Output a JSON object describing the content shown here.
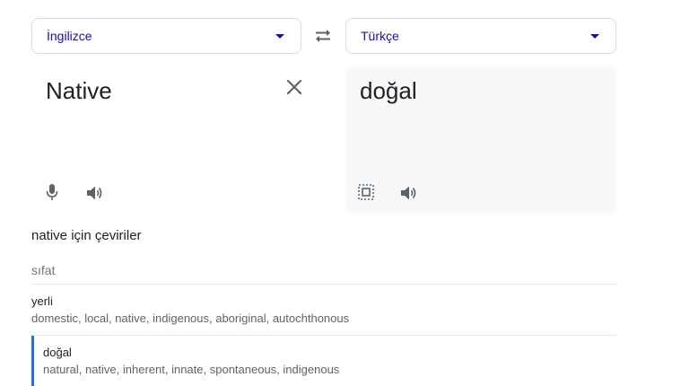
{
  "source_language": "İngilizce",
  "target_language": "Türkçe",
  "source_text": "Native",
  "translated_text": "doğal",
  "section_title": "native için çeviriler",
  "part_of_speech": "sıfat",
  "translations": [
    {
      "word": "yerli",
      "synonyms": "domestic, local, native, indigenous, aboriginal, autochthonous"
    },
    {
      "word": "doğal",
      "synonyms": "natural, native, inherent, innate, spontaneous, indigenous"
    }
  ],
  "icons": {
    "dropdown": "chevron-down-icon",
    "swap": "swap-icon",
    "clear": "close-icon",
    "mic": "mic-icon",
    "speaker": "speaker-icon",
    "select_text": "select-text-icon"
  },
  "colors": {
    "accent": "#1a0dab",
    "selected_bar": "#1a73e8",
    "panel_bg": "#f7f8fa"
  }
}
